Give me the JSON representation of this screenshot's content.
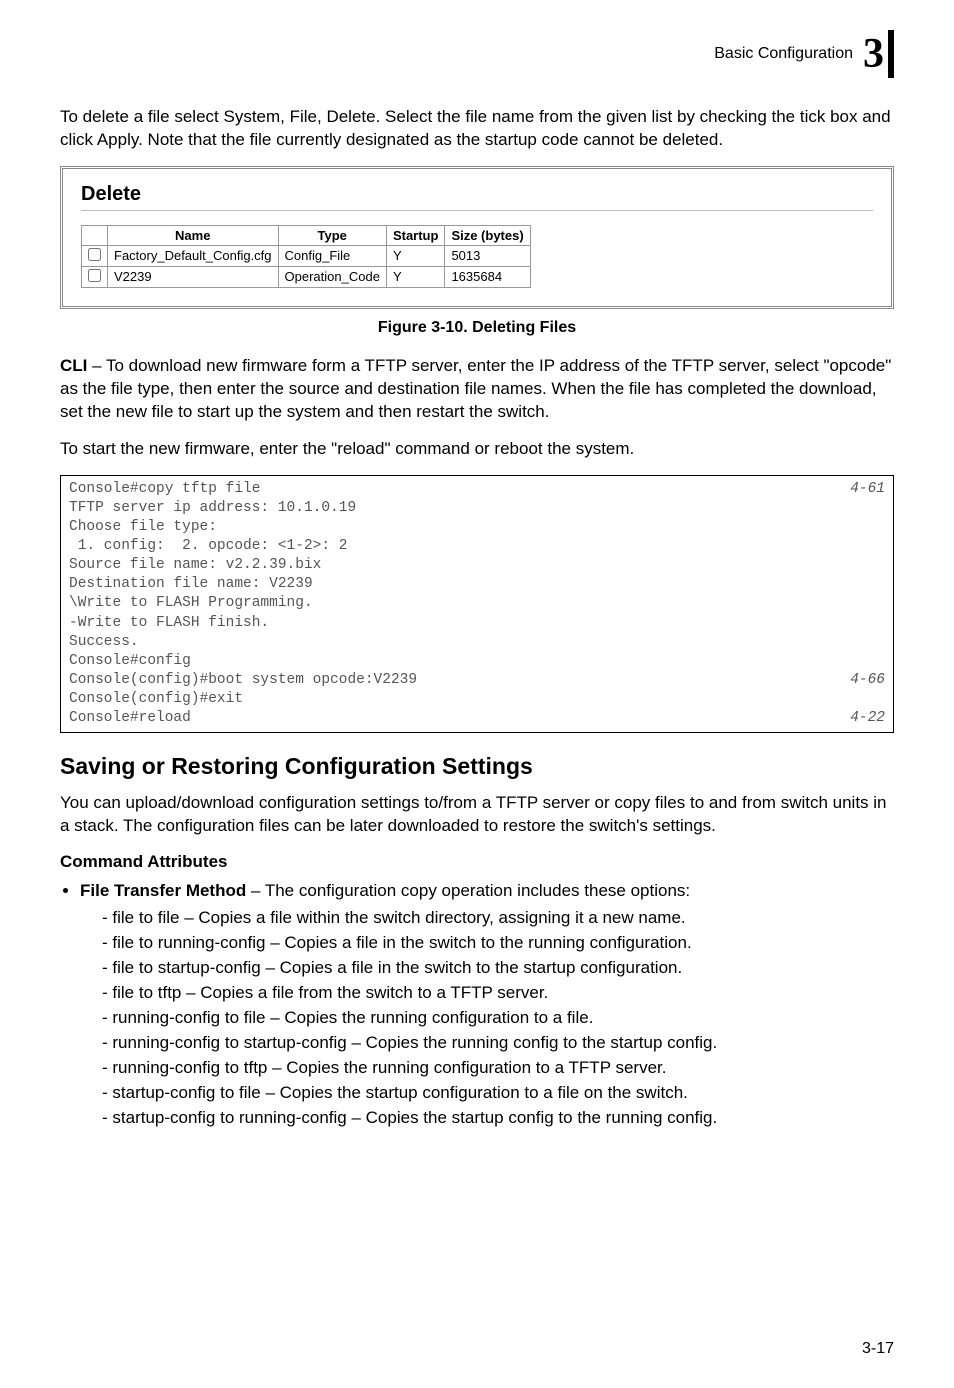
{
  "header": {
    "section_label": "Basic Configuration",
    "chapter_number": "3"
  },
  "para_delete_intro": "To delete a file select System, File, Delete. Select the file name from the given list by checking the tick box and click Apply. Note that the file currently designated as the startup code cannot be deleted.",
  "delete_panel": {
    "title": "Delete",
    "columns": {
      "c0": "",
      "c1": "Name",
      "c2": "Type",
      "c3": "Startup",
      "c4": "Size (bytes)"
    },
    "rows": [
      {
        "name": "Factory_Default_Config.cfg",
        "type": "Config_File",
        "startup": "Y",
        "size": "5013"
      },
      {
        "name": "V2239",
        "type": "Operation_Code",
        "startup": "Y",
        "size": "1635684"
      }
    ]
  },
  "figure_caption": "Figure 3-10.  Deleting Files",
  "cli_para_label": "CLI",
  "cli_para_rest": " – To download new firmware form a TFTP server, enter the IP address of the TFTP server, select \"opcode\" as the file type, then enter the source and destination file names. When the file has completed the download, set the new file to start up the system and then restart the switch.",
  "cli_start_para": "To start the new firmware, enter the \"reload\" command or reboot the system.",
  "code": {
    "l1_left": "Console#copy tftp file",
    "l1_right": "4-61",
    "l2": "TFTP server ip address: 10.1.0.19",
    "l3": "Choose file type:",
    "l4": " 1. config:  2. opcode: <1-2>: 2",
    "l5": "Source file name: v2.2.39.bix",
    "l6": "Destination file name: V2239",
    "l7": "\\Write to FLASH Programming.",
    "l8": "-Write to FLASH finish.",
    "l9": "Success.",
    "l10": "Console#config",
    "l11_left": "Console(config)#boot system opcode:V2239",
    "l11_right": "4-66",
    "l12": "Console(config)#exit",
    "l13_left": "Console#reload",
    "l13_right": "4-22"
  },
  "section_title": "Saving or Restoring Configuration Settings",
  "section_intro": "You can upload/download configuration settings to/from a TFTP server or copy files to and from switch units in a stack. The configuration files can be later downloaded to restore the switch's settings.",
  "command_attributes_heading": "Command Attributes",
  "bullet_label": "File Transfer Method",
  "bullet_rest": " – The configuration copy operation includes these options:",
  "sub_bullets": [
    "file to file – Copies a file within the switch directory, assigning it a new name.",
    "file to running-config – Copies a file in the switch to the running configuration.",
    "file to startup-config – Copies a file in the switch to the startup configuration.",
    "file to tftp – Copies a file from the switch to a TFTP server.",
    "running-config to file – Copies the running configuration to a file.",
    "running-config to startup-config – Copies the running config to the startup config.",
    "running-config to tftp – Copies the running configuration to a TFTP server.",
    "startup-config to file – Copies the startup configuration to a file on the switch.",
    "startup-config to running-config – Copies the startup config to the running config."
  ],
  "page_number": "3-17"
}
